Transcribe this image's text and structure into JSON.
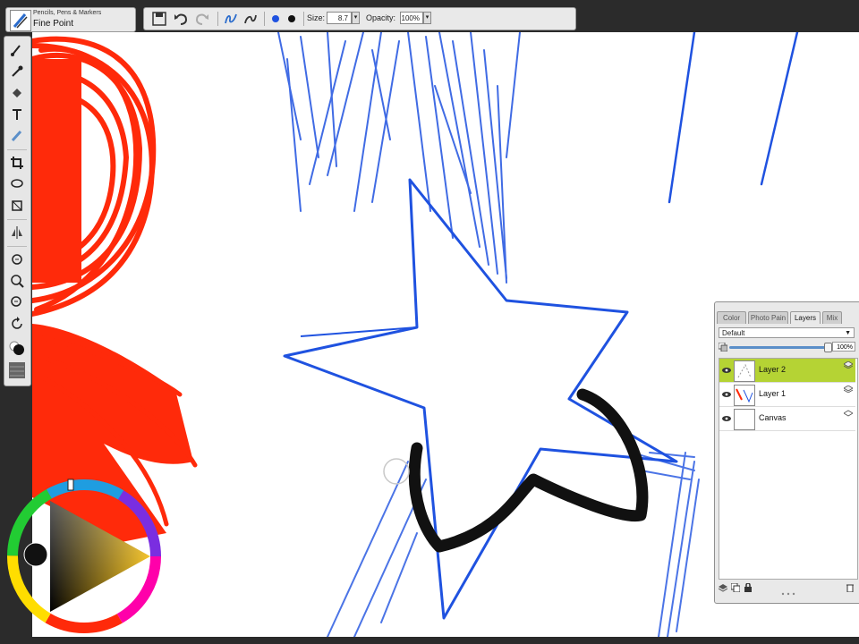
{
  "brush": {
    "category": "Pencils, Pens & Markers",
    "variant": "Fine Point"
  },
  "property_bar": {
    "size_label": "Size:",
    "size_value": "8.7",
    "opacity_label": "Opacity:",
    "opacity_value": "100%",
    "icons": [
      "save-icon",
      "undo-icon",
      "redo-icon",
      "stroke-attribute-icon",
      "brush-ghost-icon",
      "main-color-swatch",
      "secondary-color-swatch"
    ]
  },
  "toolbox": {
    "tools": [
      "brush-icon",
      "dropper-icon",
      "paint-bucket-icon",
      "text-icon",
      "blender-icon",
      "crop-icon",
      "lasso-icon",
      "transform-icon",
      "mirror-icon",
      "grabber-icon",
      "zoom-in-icon",
      "zoom-out-icon",
      "rotate-icon"
    ]
  },
  "colors": {
    "stroke_red": "#ff2a0a",
    "stroke_blue": "#1f52e0",
    "stroke_black": "#111111",
    "layer_selected": "#b5d334"
  },
  "layers_panel": {
    "tabs": [
      {
        "label": "Color",
        "active": false
      },
      {
        "label": "Photo Pain",
        "active": false
      },
      {
        "label": "Layers",
        "active": true
      },
      {
        "label": "Mix",
        "active": false
      }
    ],
    "composite": "Default",
    "opacity": "100%",
    "opacity_level": 1.0,
    "layers": [
      {
        "name": "Layer 2",
        "selected": true
      },
      {
        "name": "Layer 1",
        "selected": false
      },
      {
        "name": "Canvas",
        "selected": false
      }
    ]
  }
}
